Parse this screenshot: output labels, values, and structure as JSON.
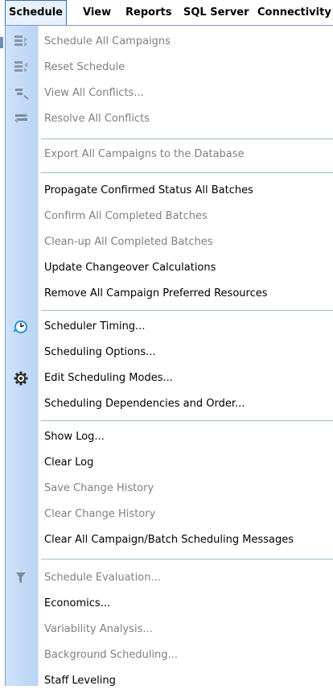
{
  "menubar": {
    "items": [
      {
        "label": "Schedule",
        "active": true
      },
      {
        "label": "View"
      },
      {
        "label": "Reports"
      },
      {
        "label": "SQL Server"
      },
      {
        "label": "Connectivity"
      }
    ]
  },
  "menu": {
    "items": [
      {
        "label": "Schedule All Campaigns",
        "enabled": false,
        "icon": "schedule-campaigns-icon"
      },
      {
        "label": "Reset Schedule",
        "enabled": false,
        "icon": "reset-schedule-icon"
      },
      {
        "label": "View All Conflicts...",
        "enabled": false,
        "icon": "view-conflicts-icon"
      },
      {
        "label": "Resolve All Conflicts",
        "enabled": false,
        "icon": "resolve-conflicts-icon"
      },
      {
        "label": "Export All Campaigns to the Database",
        "enabled": false
      },
      {
        "label": "Propagate Confirmed Status All Batches",
        "enabled": true
      },
      {
        "label": "Confirm All Completed Batches",
        "enabled": false
      },
      {
        "label": "Clean-up All Completed Batches",
        "enabled": false
      },
      {
        "label": "Update Changeover Calculations",
        "enabled": true
      },
      {
        "label": "Remove All Campaign Preferred Resources",
        "enabled": true
      },
      {
        "label": "Scheduler Timing...",
        "enabled": true,
        "icon": "timer-icon"
      },
      {
        "label": "Scheduling Options...",
        "enabled": true
      },
      {
        "label": "Edit Scheduling Modes...",
        "enabled": true,
        "icon": "gear-icon"
      },
      {
        "label": "Scheduling Dependencies and Order...",
        "enabled": true
      },
      {
        "label": "Show Log...",
        "enabled": true
      },
      {
        "label": "Clear Log",
        "enabled": true
      },
      {
        "label": "Save Change History",
        "enabled": false
      },
      {
        "label": "Clear Change History",
        "enabled": false
      },
      {
        "label": "Clear All Campaign/Batch Scheduling Messages",
        "enabled": true
      },
      {
        "label": "Schedule Evaluation...",
        "enabled": false,
        "icon": "funnel-icon"
      },
      {
        "label": "Economics...",
        "enabled": true
      },
      {
        "label": "Variability Analysis...",
        "enabled": false
      },
      {
        "label": "Background Scheduling...",
        "enabled": false
      },
      {
        "label": "Staff Leveling",
        "enabled": true
      }
    ]
  },
  "colors": {
    "menu_border": "#7a9cc4",
    "gutter": "#c4dbf7",
    "separator": "#a3bcd8",
    "disabled_text": "#808080"
  }
}
